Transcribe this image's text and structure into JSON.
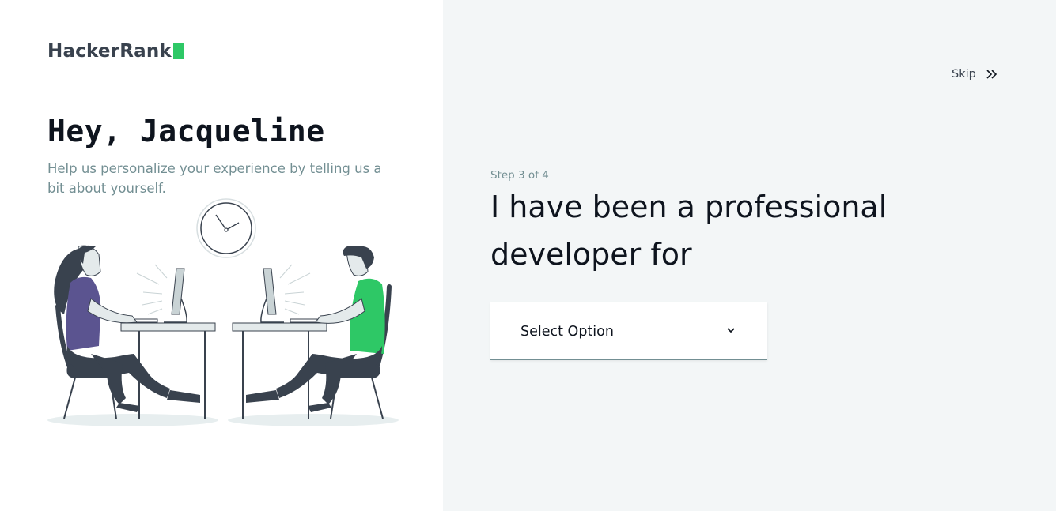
{
  "brand": {
    "name": "HackerRank",
    "accent_color": "#2ec866"
  },
  "left_panel": {
    "greeting": "Hey, Jacqueline",
    "subtext": "Help us personalize your experience by telling us a bit about yourself.",
    "illustration_icon": "two-developers-at-desks-illustration"
  },
  "right_panel": {
    "skip_label": "Skip",
    "skip_icon": "double-chevron-right-icon",
    "step": "Step 3 of 4",
    "question": "I have been a professional developer for",
    "select": {
      "value": "Select Option",
      "icon": "chevron-down-icon"
    }
  },
  "colors": {
    "heading": "#0e141e",
    "muted": "#738f93",
    "green": "#2ec866",
    "purple": "#5b5490",
    "dark": "#39424e",
    "right_bg": "#f3f6f7"
  }
}
